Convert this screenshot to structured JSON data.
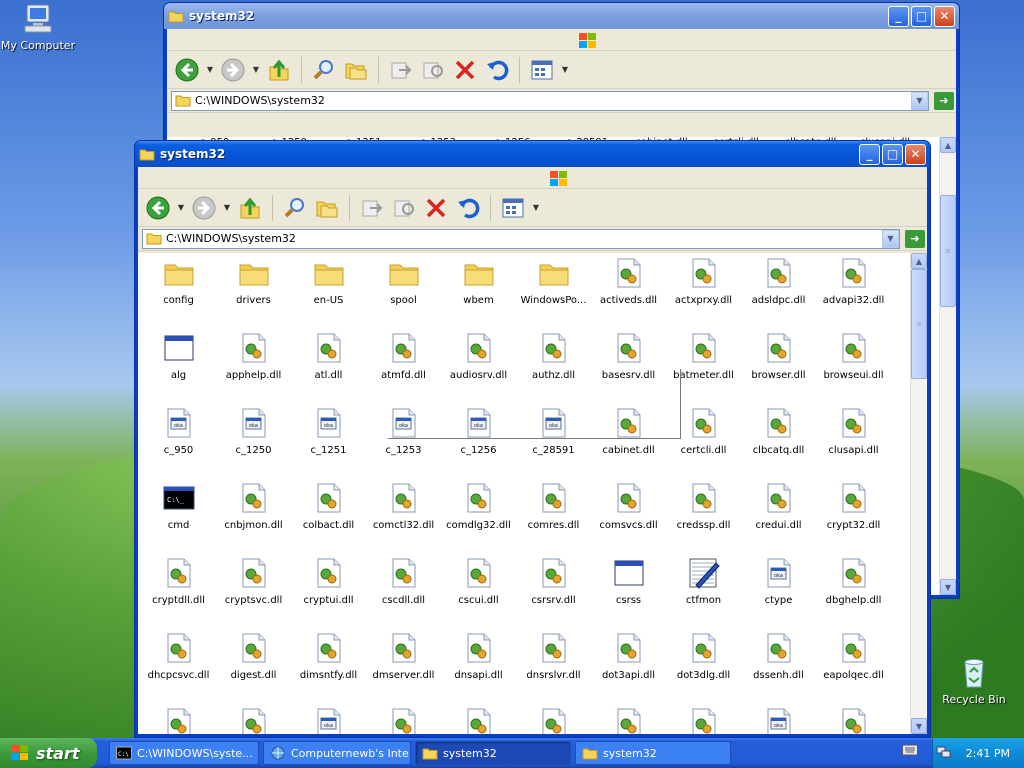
{
  "desktop": {
    "icons": [
      {
        "label": "My Computer"
      },
      {
        "label": "Recycle Bin"
      }
    ]
  },
  "window_back": {
    "title": "system32",
    "address": "C:\\WINDOWS\\system32",
    "visible_row": [
      "c_950",
      "c_1250",
      "c_1251",
      "c_1253",
      "c_1256",
      "c_28591",
      "cabinet.dll",
      "certcli.dll",
      "clbcatq.dll",
      "clusapi.dll"
    ]
  },
  "window_front": {
    "title": "system32",
    "address": "C:\\WINDOWS\\system32",
    "items": [
      {
        "label": "config",
        "icon": "folder"
      },
      {
        "label": "drivers",
        "icon": "folder"
      },
      {
        "label": "en-US",
        "icon": "folder"
      },
      {
        "label": "spool",
        "icon": "folder"
      },
      {
        "label": "wbem",
        "icon": "folder"
      },
      {
        "label": "WindowsPo...",
        "icon": "folder"
      },
      {
        "label": "activeds.dll",
        "icon": "dll"
      },
      {
        "label": "actxprxy.dll",
        "icon": "dll"
      },
      {
        "label": "adsldpc.dll",
        "icon": "dll"
      },
      {
        "label": "advapi32.dll",
        "icon": "dll"
      },
      {
        "label": "alg",
        "icon": "app"
      },
      {
        "label": "apphelp.dll",
        "icon": "dll"
      },
      {
        "label": "atl.dll",
        "icon": "dll"
      },
      {
        "label": "atmfd.dll",
        "icon": "dll"
      },
      {
        "label": "audiosrv.dll",
        "icon": "dll"
      },
      {
        "label": "authz.dll",
        "icon": "dll"
      },
      {
        "label": "basesrv.dll",
        "icon": "dll"
      },
      {
        "label": "batmeter.dll",
        "icon": "dll"
      },
      {
        "label": "browser.dll",
        "icon": "dll"
      },
      {
        "label": "browseui.dll",
        "icon": "dll"
      },
      {
        "label": "c_950",
        "icon": "nls"
      },
      {
        "label": "c_1250",
        "icon": "nls"
      },
      {
        "label": "c_1251",
        "icon": "nls"
      },
      {
        "label": "c_1253",
        "icon": "nls"
      },
      {
        "label": "c_1256",
        "icon": "nls"
      },
      {
        "label": "c_28591",
        "icon": "nls"
      },
      {
        "label": "cabinet.dll",
        "icon": "dll"
      },
      {
        "label": "certcli.dll",
        "icon": "dll"
      },
      {
        "label": "clbcatq.dll",
        "icon": "dll"
      },
      {
        "label": "clusapi.dll",
        "icon": "dll"
      },
      {
        "label": "cmd",
        "icon": "cmd"
      },
      {
        "label": "cnbjmon.dll",
        "icon": "dll"
      },
      {
        "label": "colbact.dll",
        "icon": "dll"
      },
      {
        "label": "comctl32.dll",
        "icon": "dll"
      },
      {
        "label": "comdlg32.dll",
        "icon": "dll"
      },
      {
        "label": "comres.dll",
        "icon": "dll"
      },
      {
        "label": "comsvcs.dll",
        "icon": "dll"
      },
      {
        "label": "credssp.dll",
        "icon": "dll"
      },
      {
        "label": "credui.dll",
        "icon": "dll"
      },
      {
        "label": "crypt32.dll",
        "icon": "dll"
      },
      {
        "label": "cryptdll.dll",
        "icon": "dll"
      },
      {
        "label": "cryptsvc.dll",
        "icon": "dll"
      },
      {
        "label": "cryptui.dll",
        "icon": "dll"
      },
      {
        "label": "cscdll.dll",
        "icon": "dll"
      },
      {
        "label": "cscui.dll",
        "icon": "dll"
      },
      {
        "label": "csrsrv.dll",
        "icon": "dll"
      },
      {
        "label": "csrss",
        "icon": "app"
      },
      {
        "label": "ctfmon",
        "icon": "ctf"
      },
      {
        "label": "ctype",
        "icon": "nls"
      },
      {
        "label": "dbghelp.dll",
        "icon": "dll"
      },
      {
        "label": "dhcpcsvc.dll",
        "icon": "dll"
      },
      {
        "label": "digest.dll",
        "icon": "dll"
      },
      {
        "label": "dimsntfy.dll",
        "icon": "dll"
      },
      {
        "label": "dmserver.dll",
        "icon": "dll"
      },
      {
        "label": "dnsapi.dll",
        "icon": "dll"
      },
      {
        "label": "dnsrslvr.dll",
        "icon": "dll"
      },
      {
        "label": "dot3api.dll",
        "icon": "dll"
      },
      {
        "label": "dot3dlg.dll",
        "icon": "dll"
      },
      {
        "label": "dssenh.dll",
        "icon": "dll"
      },
      {
        "label": "eapolqec.dll",
        "icon": "dll"
      },
      {
        "label": "",
        "icon": "dll"
      },
      {
        "label": "",
        "icon": "dll"
      },
      {
        "label": "",
        "icon": "nls"
      },
      {
        "label": "",
        "icon": "dll"
      },
      {
        "label": "",
        "icon": "dll"
      },
      {
        "label": "",
        "icon": "dll"
      },
      {
        "label": "",
        "icon": "dll"
      },
      {
        "label": "",
        "icon": "dll"
      },
      {
        "label": "",
        "icon": "nls"
      },
      {
        "label": "",
        "icon": "dll"
      }
    ]
  },
  "taskbar": {
    "start_label": "start",
    "tasks": [
      {
        "label": "C:\\WINDOWS\\syste...",
        "icon": "cmd",
        "active": false
      },
      {
        "label": "Computernewb's Inte...",
        "icon": "globe",
        "active": false
      },
      {
        "label": "system32",
        "icon": "folder",
        "active": true
      },
      {
        "label": "system32",
        "icon": "folder",
        "active": false
      }
    ],
    "clock": "2:41 PM"
  }
}
